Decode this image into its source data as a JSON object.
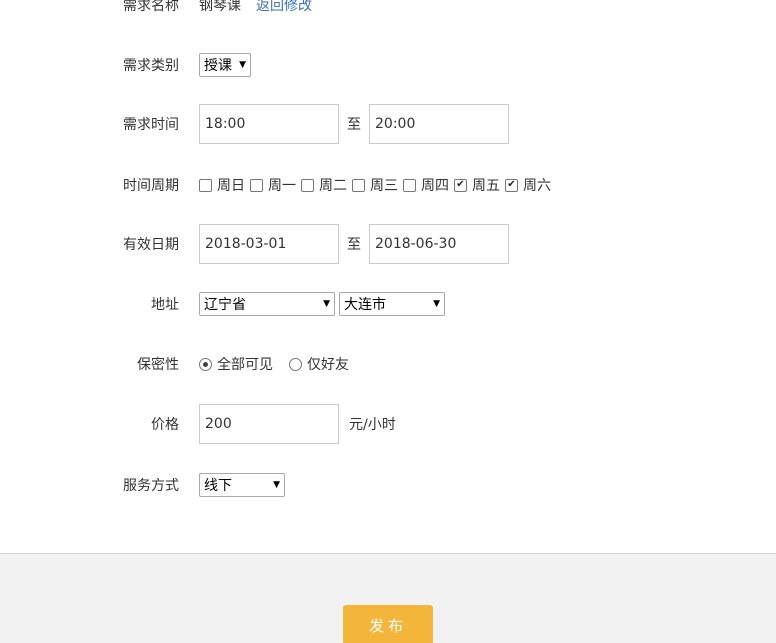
{
  "form": {
    "name": {
      "label": "需求名称",
      "value": "钢琴课",
      "edit_link": "返回修改"
    },
    "category": {
      "label": "需求类别",
      "selected": "授课"
    },
    "time": {
      "label": "需求时间",
      "start": "18:00",
      "separator": "至",
      "end": "20:00"
    },
    "cycle": {
      "label": "时间周期",
      "days": [
        {
          "label": "周日",
          "checked": false
        },
        {
          "label": "周一",
          "checked": false
        },
        {
          "label": "周二",
          "checked": false
        },
        {
          "label": "周三",
          "checked": false
        },
        {
          "label": "周四",
          "checked": false
        },
        {
          "label": "周五",
          "checked": true
        },
        {
          "label": "周六",
          "checked": true
        }
      ]
    },
    "valid_dates": {
      "label": "有效日期",
      "start": "2018-03-01",
      "separator": "至",
      "end": "2018-06-30"
    },
    "address": {
      "label": "地址",
      "province": "辽宁省",
      "city": "大连市"
    },
    "privacy": {
      "label": "保密性",
      "options": [
        {
          "label": "全部可见",
          "selected": true
        },
        {
          "label": "仅好友",
          "selected": false
        }
      ]
    },
    "price": {
      "label": "价格",
      "value": "200",
      "unit": "元/小时"
    },
    "service": {
      "label": "服务方式",
      "selected": "线下"
    }
  },
  "footer": {
    "publish_label": "发布"
  },
  "icons": {
    "caret": "caret-down-icon",
    "check": "checkmark-icon"
  },
  "colors": {
    "link": "#3b6fb6",
    "publish_button": "#f3b53a",
    "footer_bg": "#f2f2f2"
  }
}
